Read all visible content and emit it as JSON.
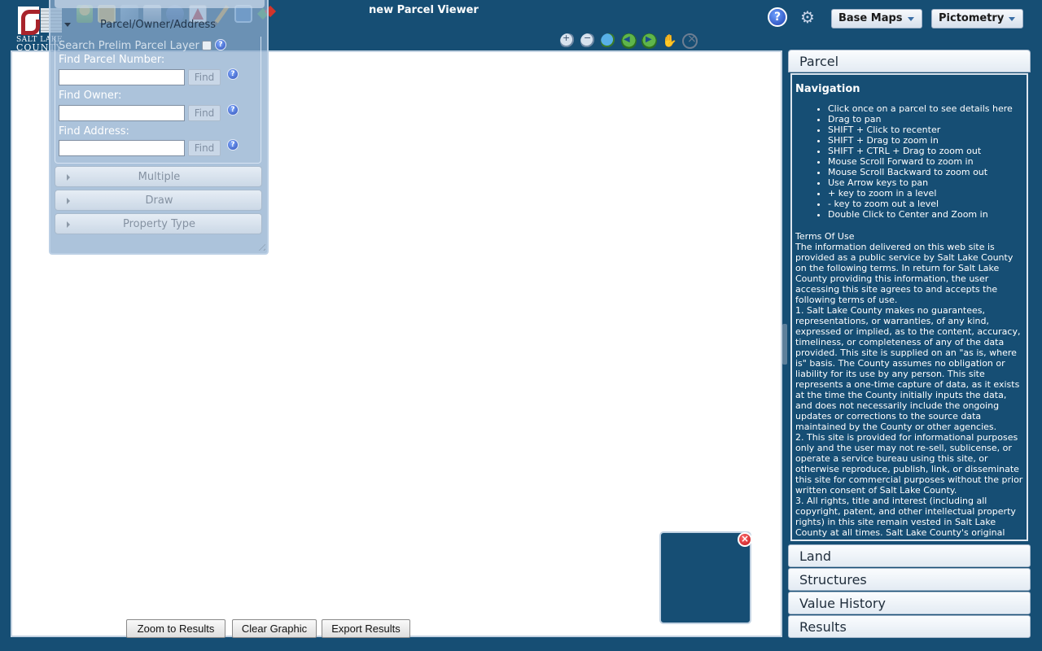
{
  "header": {
    "app_title": "new Parcel Viewer",
    "logo": {
      "line1": "SALT LAKE",
      "line2": "COUNTY"
    },
    "toolbar_icons": [
      "identify-pin-icon",
      "select-rectangle-icon",
      "layers-icon",
      "print-icon",
      "measure-icon",
      "pdf-icon",
      "pencil-icon",
      "document-icon",
      "transfer-icon"
    ],
    "help_label": "?",
    "base_maps_label": "Base Maps",
    "pictometry_label": "Pictometry"
  },
  "nav_tools": [
    "zoom-in-icon",
    "zoom-out-icon",
    "full-extent-icon",
    "previous-extent-icon",
    "next-extent-icon",
    "pan-icon",
    "stop-icon"
  ],
  "search_panel": {
    "header_label": "Parcel/Owner/Address",
    "prelim_label": "Search Prelim Parcel Layer",
    "help_label": "?",
    "find_label": "Find",
    "fields": [
      {
        "label": "Find Parcel Number:",
        "value": ""
      },
      {
        "label": "Find Owner:",
        "value": ""
      },
      {
        "label": "Find Address:",
        "value": ""
      }
    ],
    "sections": [
      "Multiple",
      "Draw",
      "Property Type"
    ]
  },
  "map": {
    "buttons": {
      "zoom": "Zoom to Results",
      "clear": "Clear Graphic",
      "export": "Export Results"
    },
    "overview_close": "×"
  },
  "info_panel": {
    "active_tab": "Parcel",
    "heading": "Navigation",
    "nav_items": [
      "Click once on a parcel to see details here",
      "Drag to pan",
      "SHIFT + Click to recenter",
      "SHIFT + Drag to zoom in",
      "SHIFT + CTRL + Drag to zoom out",
      "Mouse Scroll Forward to zoom in",
      "Mouse Scroll Backward to zoom out",
      "Use Arrow keys to pan",
      "+ key to zoom in a level",
      "- key to zoom out a level",
      "Double Click to Center and Zoom in"
    ],
    "terms_title": "Terms Of Use",
    "terms_text": "The information delivered on this web site is provided as a public service by Salt Lake County on the following terms. In return for Salt Lake County providing this information, the user accessing this site agrees to and accepts the following terms of use.\n1. Salt Lake County makes no guarantees, representations, or warranties, of any kind, expressed or implied, as to the content, accuracy, timeliness, or completeness of any of the data provided. This site is supplied on an \"as is, where is\" basis. The County assumes no obligation or liability for its use by any person. This site represents a one-time capture of data, as it exists at the time the County initially inputs the data, and does not necessarily include the ongoing updates or corrections to the source data maintained by the County or other agencies.\n2. This site is provided for informational purposes only and the user may not re-sell, sublicense, or operate a service bureau using this site, or otherwise reproduce, publish, link, or disseminate this site for commercial purposes without the prior written consent of Salt Lake County.\n3. All rights, title and interest (including all copyright, patent, and other intellectual property rights) in this site remain vested in Salt Lake County at all times. Salt Lake County's original",
    "sections": [
      "Land",
      "Structures",
      "Value History",
      "Results"
    ]
  }
}
